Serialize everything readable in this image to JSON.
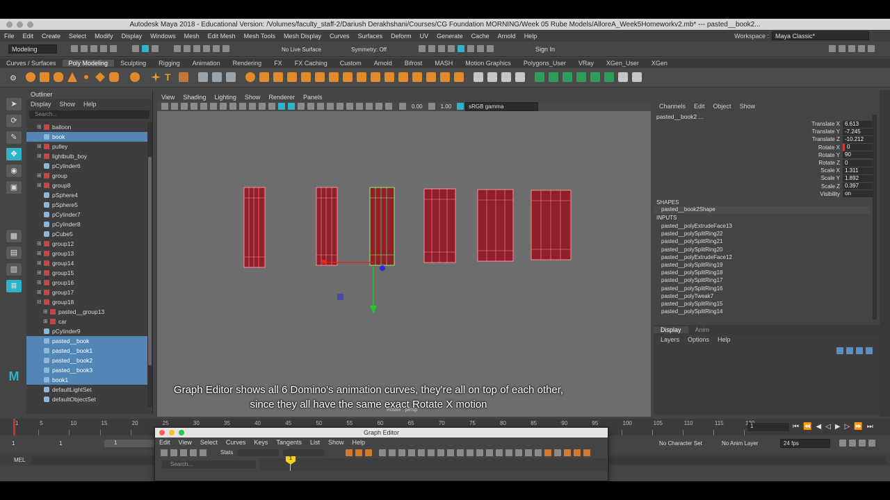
{
  "window": {
    "title": "Autodesk Maya 2018 - Educational Version: /Volumes/faculty_staff-2/Dariush Derakhshani/Courses/CG Foundation MORNING/Week 05 Rube Models/AlloreA_Week5Homeworkv2.mb*  ---  pasted__book2..."
  },
  "menubar": {
    "items": [
      "File",
      "Edit",
      "Create",
      "Select",
      "Modify",
      "Display",
      "Windows",
      "Mesh",
      "Edit Mesh",
      "Mesh Tools",
      "Mesh Display",
      "Curves",
      "Surfaces",
      "Deform",
      "UV",
      "Generate",
      "Cache",
      "Arnold",
      "Help"
    ]
  },
  "workspace": {
    "label": "Workspace :",
    "value": "Maya Classic*"
  },
  "status": {
    "mode": "Modeling",
    "live_surface": "No Live Surface",
    "symmetry": "Symmetry: Off",
    "sign_in": "Sign In"
  },
  "shelf": {
    "tabs": [
      "Curves / Surfaces",
      "Poly Modeling",
      "Sculpting",
      "Rigging",
      "Animation",
      "Rendering",
      "FX",
      "FX Caching",
      "Custom",
      "Arnold",
      "Bifrost",
      "MASH",
      "Motion Graphics",
      "Polygons_User",
      "VRay",
      "XGen_User",
      "XGen"
    ],
    "active": "Poly Modeling"
  },
  "outliner": {
    "title": "Outliner",
    "menu": [
      "Display",
      "Show",
      "Help"
    ],
    "search_placeholder": "Search...",
    "items": [
      {
        "label": "balloon",
        "sel": false,
        "pm": "⊞",
        "indent": 1
      },
      {
        "label": "book",
        "sel": true,
        "pm": "",
        "indent": 1
      },
      {
        "label": "pulley",
        "sel": false,
        "pm": "⊞",
        "indent": 1
      },
      {
        "label": "lightbulb_boy",
        "sel": false,
        "pm": "⊞",
        "indent": 1
      },
      {
        "label": "pCylinder6",
        "sel": false,
        "pm": "",
        "indent": 1
      },
      {
        "label": "group",
        "sel": false,
        "pm": "⊞",
        "indent": 1
      },
      {
        "label": "group8",
        "sel": false,
        "pm": "⊞",
        "indent": 1
      },
      {
        "label": "pSphere4",
        "sel": false,
        "pm": "",
        "indent": 1
      },
      {
        "label": "pSphere5",
        "sel": false,
        "pm": "",
        "indent": 1
      },
      {
        "label": "pCylinder7",
        "sel": false,
        "pm": "",
        "indent": 1
      },
      {
        "label": "pCylinder8",
        "sel": false,
        "pm": "",
        "indent": 1
      },
      {
        "label": "pCube5",
        "sel": false,
        "pm": "",
        "indent": 1
      },
      {
        "label": "group12",
        "sel": false,
        "pm": "⊞",
        "indent": 1
      },
      {
        "label": "group13",
        "sel": false,
        "pm": "⊞",
        "indent": 1
      },
      {
        "label": "group14",
        "sel": false,
        "pm": "⊞",
        "indent": 1
      },
      {
        "label": "group15",
        "sel": false,
        "pm": "⊞",
        "indent": 1
      },
      {
        "label": "group16",
        "sel": false,
        "pm": "⊞",
        "indent": 1
      },
      {
        "label": "group17",
        "sel": false,
        "pm": "⊞",
        "indent": 1
      },
      {
        "label": "group18",
        "sel": false,
        "pm": "⊟",
        "indent": 1
      },
      {
        "label": "pasted__group13",
        "sel": false,
        "pm": "⊞",
        "indent": 2
      },
      {
        "label": "car",
        "sel": false,
        "pm": "⊞",
        "indent": 2
      },
      {
        "label": "pCylinder9",
        "sel": false,
        "pm": "",
        "indent": 1
      },
      {
        "label": "pasted__book",
        "sel": true,
        "pm": "",
        "indent": 1
      },
      {
        "label": "pasted__book1",
        "sel": true,
        "pm": "",
        "indent": 1
      },
      {
        "label": "pasted__book2",
        "sel": true,
        "pm": "",
        "indent": 1
      },
      {
        "label": "pasted__book3",
        "sel": true,
        "pm": "",
        "indent": 1
      },
      {
        "label": "book1",
        "sel": true,
        "pm": "",
        "indent": 1
      },
      {
        "label": "defaultLightSet",
        "sel": false,
        "pm": "",
        "indent": 1
      },
      {
        "label": "defaultObjectSet",
        "sel": false,
        "pm": "",
        "indent": 1
      }
    ]
  },
  "viewport": {
    "menu": [
      "View",
      "Shading",
      "Lighting",
      "Show",
      "Renderer",
      "Panels"
    ],
    "field_a": "0.00",
    "field_b": "1.00",
    "color_space": "sRGB gamma",
    "camera_label": "Rotate : persp"
  },
  "channelbox": {
    "menu": [
      "Channels",
      "Edit",
      "Object",
      "Show"
    ],
    "object": "pasted__book2 ...",
    "channels": [
      {
        "label": "Translate X",
        "value": "6.613"
      },
      {
        "label": "Translate Y",
        "value": "-7.245"
      },
      {
        "label": "Translate Z",
        "value": "-10.212"
      },
      {
        "label": "Rotate X",
        "value": "0"
      },
      {
        "label": "Rotate Y",
        "value": "90"
      },
      {
        "label": "Rotate Z",
        "value": "0"
      },
      {
        "label": "Scale X",
        "value": "1.311"
      },
      {
        "label": "Scale Y",
        "value": "1.892"
      },
      {
        "label": "Scale Z",
        "value": "0.397"
      },
      {
        "label": "Visibility",
        "value": "on"
      }
    ],
    "shapes_label": "SHAPES",
    "shape": "pasted__book2Shape",
    "inputs_label": "INPUTS",
    "inputs": [
      "pasted__polyExtrudeFace13",
      "pasted__polySplitRing22",
      "pasted__polySplitRing21",
      "pasted__polySplitRing20",
      "pasted__polyExtrudeFace12",
      "pasted__polySplitRing19",
      "pasted__polySplitRing18",
      "pasted__polySplitRing17",
      "pasted__polySplitRing16",
      "pasted__polyTweak7",
      "pasted__polySplitRing15",
      "pasted__polySplitRing14"
    ]
  },
  "layers": {
    "tabs": [
      "Display",
      "Anim"
    ],
    "menu": [
      "Layers",
      "Options",
      "Help"
    ]
  },
  "timeline": {
    "ticks": [
      "1",
      "5",
      "10",
      "15",
      "20",
      "25",
      "30",
      "35",
      "40",
      "45",
      "50",
      "55",
      "60",
      "65",
      "70",
      "75",
      "80",
      "85",
      "90",
      "95",
      "100",
      "105",
      "110",
      "115",
      "120"
    ],
    "current_frame": "1"
  },
  "range": {
    "start": "1",
    "inner_start": "1",
    "inner_box": "1",
    "char_set": "No Character Set",
    "anim_layer": "No Anim Layer",
    "fps": "24 fps"
  },
  "cmdline": {
    "label": "MEL"
  },
  "graph_editor": {
    "title": "Graph Editor",
    "menu": [
      "Edit",
      "View",
      "Select",
      "Curves",
      "Keys",
      "Tangents",
      "List",
      "Show",
      "Help"
    ],
    "stats_label": "Stats",
    "search_placeholder": "Search...",
    "marker": "1"
  },
  "caption": {
    "line1": "Graph Editor shows all 6 Domino's animation curves, they're all on top of each other,",
    "line2": "since they all have the same exact Rotate X motion"
  },
  "colors": {
    "selection": "#5286b6",
    "domino": "#8f1f28",
    "domino_wire": "#ff6d7a",
    "selected_wire": "#6dff6d",
    "maya_accent": "#2fb3c8"
  },
  "icons": {
    "maya_logo": "maya-logo-icon"
  }
}
